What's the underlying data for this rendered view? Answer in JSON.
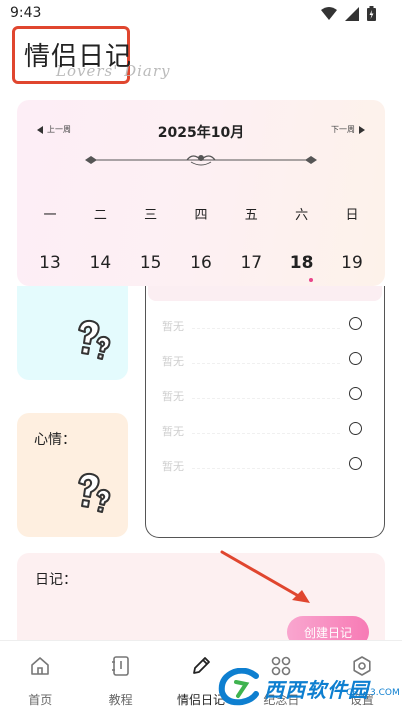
{
  "status_bar": {
    "time": "9:43",
    "icons": [
      "wifi-icon",
      "signal-icon",
      "battery-icon"
    ]
  },
  "header": {
    "title": "情侣日记",
    "subtitle": "Lovers' Diary"
  },
  "calendar": {
    "prev_week": "上一周",
    "next_week": "下一周",
    "month": "2025年10月",
    "weekdays": [
      "一",
      "二",
      "三",
      "四",
      "五",
      "六",
      "日"
    ],
    "dates": [
      "13",
      "14",
      "15",
      "16",
      "17",
      "18",
      "19"
    ],
    "selected_date": "18"
  },
  "mood": {
    "label": "心情："
  },
  "todo": {
    "items": [
      "暂无",
      "暂无",
      "暂无",
      "暂无",
      "暂无"
    ]
  },
  "diary": {
    "label": "日记：",
    "create_button": "创建日记"
  },
  "nav": {
    "items": [
      {
        "label": "首页",
        "icon": "home-icon"
      },
      {
        "label": "教程",
        "icon": "book-icon"
      },
      {
        "label": "情侣日记",
        "icon": "pen-icon"
      },
      {
        "label": "纪念日",
        "icon": "grid-icon"
      },
      {
        "label": "设置",
        "icon": "gear-icon"
      }
    ],
    "active": "情侣日记"
  },
  "watermark": {
    "text": "西西软件园",
    "sub": "CR173.COM"
  },
  "colors": {
    "accent_pink": "#f77bb5",
    "annotation_red": "#e0462f",
    "watermark_blue": "#0e7fd0"
  }
}
